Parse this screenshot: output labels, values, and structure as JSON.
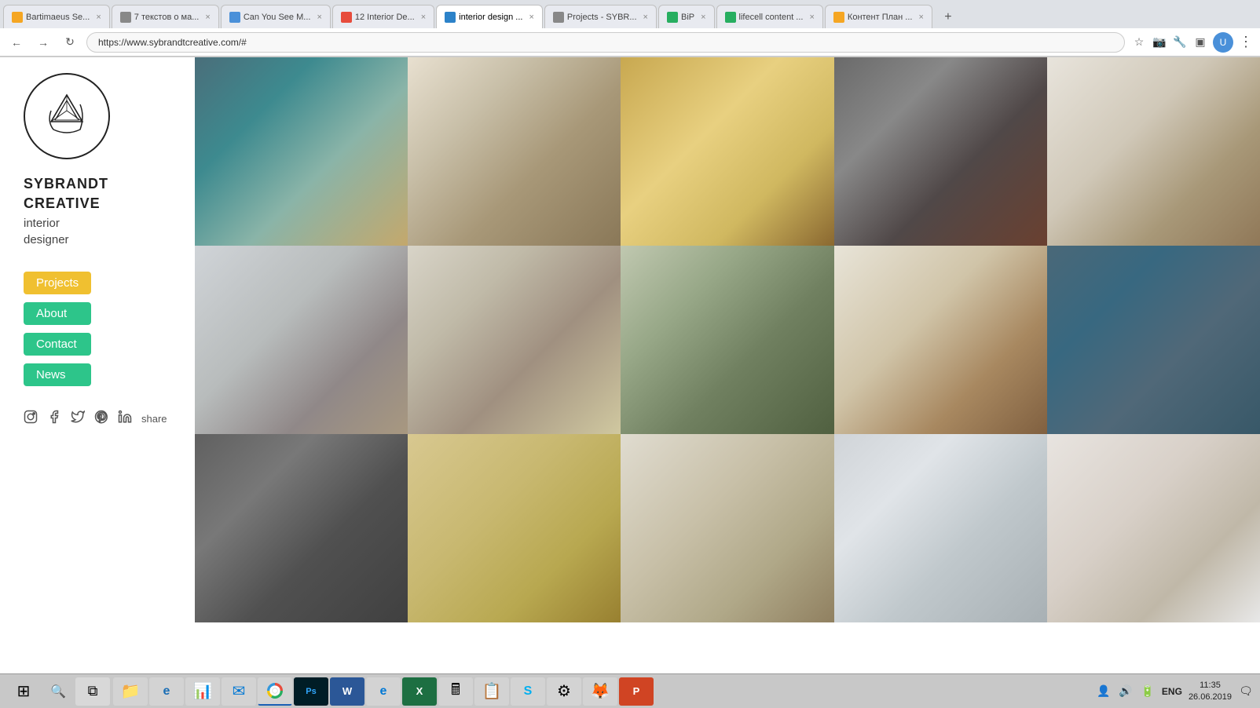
{
  "browser": {
    "tabs": [
      {
        "id": 1,
        "label": "Bartimaeus Se...",
        "favicon_color": "#f5a623",
        "active": false,
        "closable": true
      },
      {
        "id": 2,
        "label": "7 текстов о ма...",
        "favicon_color": "#888",
        "active": false,
        "closable": true
      },
      {
        "id": 3,
        "label": "Can You See M...",
        "favicon_color": "#4a90d9",
        "active": false,
        "closable": true
      },
      {
        "id": 4,
        "label": "12 Interior De...",
        "favicon_color": "#e74c3c",
        "active": false,
        "closable": true
      },
      {
        "id": 5,
        "label": "interior design ...",
        "favicon_color": "#2c82c9",
        "active": true,
        "closable": true
      },
      {
        "id": 6,
        "label": "Projects - SYBR...",
        "favicon_color": "#888",
        "active": false,
        "closable": true
      },
      {
        "id": 7,
        "label": "BiP",
        "favicon_color": "#27ae60",
        "active": false,
        "closable": true
      },
      {
        "id": 8,
        "label": "lifecell content ...",
        "favicon_color": "#27ae60",
        "active": false,
        "closable": true
      },
      {
        "id": 9,
        "label": "Контент План ...",
        "favicon_color": "#f5a623",
        "active": false,
        "closable": true
      }
    ],
    "url": "https://www.sybrandtcreative.com/#",
    "add_tab_label": "+"
  },
  "sidebar": {
    "brand": {
      "line1": "SYBRANDT",
      "line2": "CREATIVE",
      "sub1": "interior",
      "sub2": "designer"
    },
    "nav": {
      "projects": "Projects",
      "about": "About",
      "contact": "Contact",
      "news": "News"
    },
    "social": {
      "instagram": "📷",
      "facebook": "f",
      "twitter": "t",
      "pinterest": "p",
      "linkedin": "in",
      "share": "share"
    }
  },
  "grid": {
    "images": [
      {
        "id": 1,
        "alt": "Teal hexagon tile kitchen"
      },
      {
        "id": 2,
        "alt": "Modern white kitchen with island"
      },
      {
        "id": 3,
        "alt": "Gold geometric staircase"
      },
      {
        "id": 4,
        "alt": "Living room with TV and fireplace"
      },
      {
        "id": 5,
        "alt": "Kitchen with wood cabinets"
      },
      {
        "id": 6,
        "alt": "Bathroom with mirror and vanity"
      },
      {
        "id": 7,
        "alt": "Kitchen with bar stools"
      },
      {
        "id": 8,
        "alt": "Kitchen with pendant light"
      },
      {
        "id": 9,
        "alt": "Bathroom with round mirror and green wallpaper"
      },
      {
        "id": 10,
        "alt": "White kitchen with appliances"
      },
      {
        "id": 11,
        "alt": "Kitchen with dark backsplash"
      },
      {
        "id": 12,
        "alt": "Living room with sofa"
      },
      {
        "id": 13,
        "alt": "Kitchen with gold pendants"
      },
      {
        "id": 14,
        "alt": "Bright living room"
      },
      {
        "id": 15,
        "alt": "Living room with shelves"
      }
    ]
  },
  "taskbar": {
    "apps": [
      {
        "name": "windows",
        "icon": "⊞",
        "active": false
      },
      {
        "name": "search",
        "icon": "🔍",
        "active": false
      },
      {
        "name": "task-view",
        "icon": "⧉",
        "active": false
      },
      {
        "name": "explorer",
        "icon": "📁",
        "active": false
      },
      {
        "name": "ie",
        "icon": "🌐",
        "active": false
      },
      {
        "name": "ie-alt",
        "icon": "e",
        "active": false
      },
      {
        "name": "app3",
        "icon": "📊",
        "active": false
      },
      {
        "name": "outlook",
        "icon": "✉",
        "active": false
      },
      {
        "name": "chrome",
        "icon": "◉",
        "active": true
      },
      {
        "name": "photoshop",
        "icon": "Ps",
        "active": false
      },
      {
        "name": "word",
        "icon": "W",
        "active": false
      },
      {
        "name": "edge",
        "icon": "e",
        "active": false
      },
      {
        "name": "excel",
        "icon": "X",
        "active": false
      },
      {
        "name": "calc",
        "icon": "🖩",
        "active": false
      },
      {
        "name": "app4",
        "icon": "📋",
        "active": false
      },
      {
        "name": "skype",
        "icon": "S",
        "active": false
      },
      {
        "name": "settings",
        "icon": "⚙",
        "active": false
      },
      {
        "name": "browser2",
        "icon": "🦊",
        "active": false
      },
      {
        "name": "ppt",
        "icon": "P",
        "active": false
      }
    ],
    "right": {
      "network": "📶",
      "sound": "🔊",
      "battery": "🔋",
      "lang": "ENG",
      "time": "11:35",
      "date": "26.06.2019",
      "notification": "🗨"
    }
  }
}
